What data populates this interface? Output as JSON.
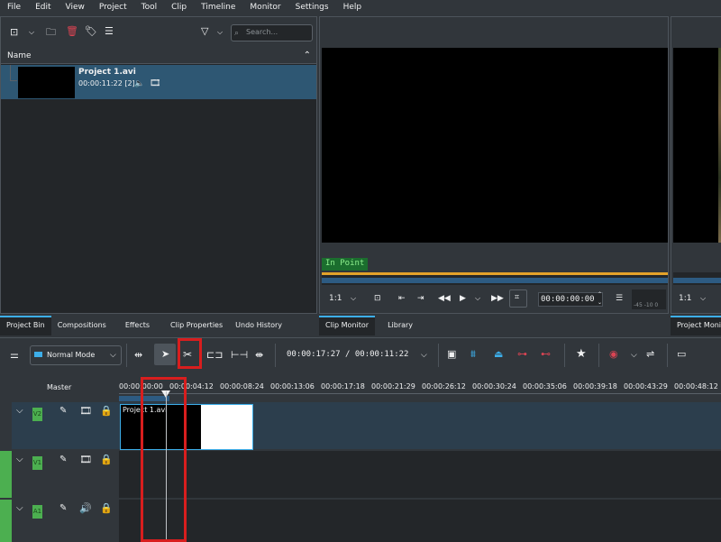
{
  "menubar": [
    "File",
    "Edit",
    "View",
    "Project",
    "Tool",
    "Clip",
    "Timeline",
    "Monitor",
    "Settings",
    "Help"
  ],
  "bin": {
    "search_placeholder": "Search...",
    "column_header": "Name",
    "clip": {
      "name": "Project 1.avi",
      "duration": "00:00:11:22 [2]"
    }
  },
  "bottom_tabs_left": [
    "Project Bin",
    "Compositions",
    "Effects",
    "Clip Properties",
    "Undo History"
  ],
  "monitor_tabs": [
    "Clip Monitor",
    "Library"
  ],
  "project_monitor_tab": "Project Monitor",
  "clip_monitor": {
    "in_point_label": "In Point",
    "zoom": "1:1",
    "timecode": "00:00:00:00",
    "audio_scale": "-45 -10 0"
  },
  "project_monitor": {
    "zoom": "1:1"
  },
  "timeline_toolbar": {
    "mode": "Normal Mode",
    "timecode": "00:00:17:27 / 00:00:11:22"
  },
  "timeline": {
    "master_label": "Master",
    "ruler_ticks": [
      "00:00:00:00",
      "00:00:04:12",
      "00:00:08:24",
      "00:00:13:06",
      "00:00:17:18",
      "00:00:21:29",
      "00:00:26:12",
      "00:00:30:24",
      "00:00:35:06",
      "00:00:39:18",
      "00:00:43:29",
      "00:00:48:12"
    ],
    "tracks": [
      {
        "name": "V2"
      },
      {
        "name": "V1"
      },
      {
        "name": "A1"
      }
    ],
    "clip_label": "Project 1.avi"
  },
  "colors": {
    "accent": "#3daee9",
    "track_active": "#4caf50",
    "highlight": "#d81e1e"
  }
}
